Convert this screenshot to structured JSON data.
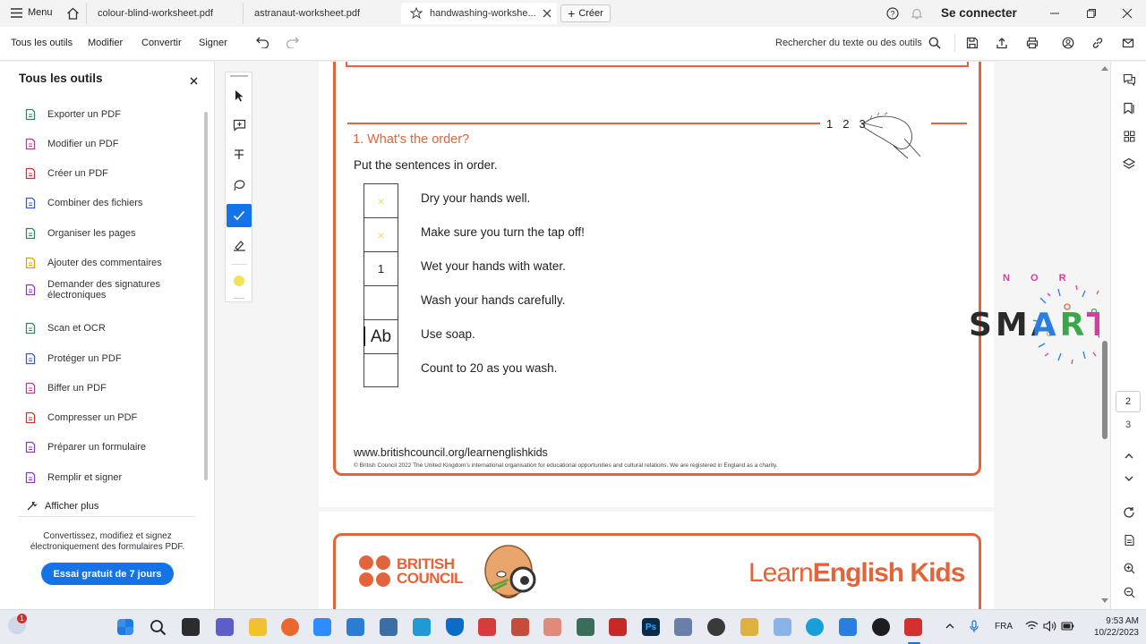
{
  "titlebar": {
    "menu_label": "Menu",
    "tabs": [
      {
        "label": "colour-blind-worksheet.pdf"
      },
      {
        "label": "astranaut-worksheet.pdf"
      },
      {
        "label": "handwashing-workshe..."
      }
    ],
    "create_label": "Créer",
    "signin_label": "Se connecter"
  },
  "toolbar": {
    "all_tools": "Tous les outils",
    "edit": "Modifier",
    "convert": "Convertir",
    "sign": "Signer",
    "search_text": "Rechercher du texte ou des outils"
  },
  "leftpanel": {
    "title": "Tous les outils",
    "items": [
      {
        "label": "Exporter un PDF",
        "icon": "export-pdf-icon",
        "color": "#2e8b57"
      },
      {
        "label": "Modifier un PDF",
        "icon": "edit-pdf-icon",
        "color": "#c0399a"
      },
      {
        "label": "Créer un PDF",
        "icon": "create-pdf-icon",
        "color": "#d03434"
      },
      {
        "label": "Combiner des fichiers",
        "icon": "combine-files-icon",
        "color": "#3b5bd6"
      },
      {
        "label": "Organiser les pages",
        "icon": "organize-pages-icon",
        "color": "#2e8b57"
      },
      {
        "label": "Ajouter des commentaires",
        "icon": "comment-icon",
        "color": "#d6a400"
      },
      {
        "label": "Demander des signatures électroniques",
        "icon": "request-signature-icon",
        "color": "#8a3cc9"
      },
      {
        "label": "Scan et OCR",
        "icon": "scan-ocr-icon",
        "color": "#2e8b57"
      },
      {
        "label": "Protéger un PDF",
        "icon": "protect-pdf-icon",
        "color": "#3b5bd6"
      },
      {
        "label": "Biffer un PDF",
        "icon": "redact-pdf-icon",
        "color": "#c0399a"
      },
      {
        "label": "Compresser un PDF",
        "icon": "compress-pdf-icon",
        "color": "#d03434"
      },
      {
        "label": "Préparer un formulaire",
        "icon": "prepare-form-icon",
        "color": "#8a3cc9"
      },
      {
        "label": "Remplir et signer",
        "icon": "fill-sign-icon",
        "color": "#8a3cc9"
      }
    ],
    "more_label": "Afficher plus",
    "promo_text": "Convertissez, modifiez et signez électroniquement des formulaires PDF.",
    "trial_button": "Essai gratuit de 7 jours"
  },
  "document": {
    "scale_numbers": [
      "1",
      "2",
      "3"
    ],
    "section_title": "1. What's the order?",
    "instruction": "Put the sentences in order.",
    "rows": [
      {
        "box": "×",
        "sentence": "Dry your hands well."
      },
      {
        "box": "×",
        "sentence": "Make sure you turn the tap off!"
      },
      {
        "box": "1",
        "sentence": "Wet your hands with water."
      },
      {
        "box": "",
        "sentence": "Wash your hands carefully."
      },
      {
        "box": "Ab",
        "sentence": "Use soap."
      },
      {
        "box": "",
        "sentence": "Count to 20 as you wash."
      }
    ],
    "url": "www.britishcouncil.org/learnenglishkids",
    "copyright": "© British Council 2022 The United Kingdom's international organisation for educational opportunities and cultural relations. We are registered in England as a charity.",
    "bc_line1": "BRITISH",
    "bc_line2": "COUNCIL",
    "learn_light": "Learn",
    "learn_bold": "English Kids",
    "accent_color": "#e3643a"
  },
  "watermark": {
    "word": "SMART",
    "small": "N O R"
  },
  "rightbar": {
    "pages": [
      "2",
      "3"
    ]
  },
  "taskbar": {
    "lang": "FRA",
    "time": "9:53 AM",
    "date": "10/22/2023",
    "badge": "1"
  }
}
